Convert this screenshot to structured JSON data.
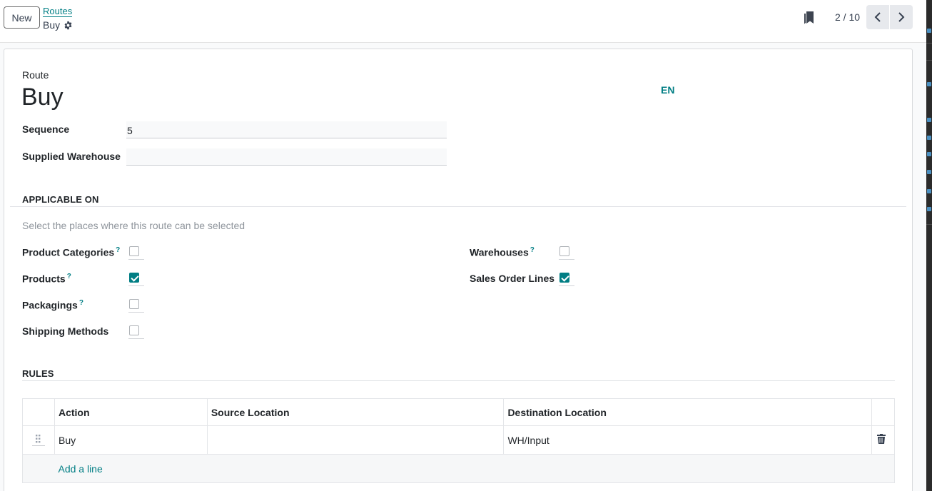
{
  "control_panel": {
    "new_button": "New",
    "breadcrumb_parent": "Routes",
    "breadcrumb_current": "Buy",
    "pager": "2 / 10"
  },
  "form": {
    "route_label": "Route",
    "route_name": "Buy",
    "language": "EN",
    "sequence_label": "Sequence",
    "sequence_value": "5",
    "supplied_warehouse_label": "Supplied Warehouse",
    "supplied_warehouse_value": ""
  },
  "applicable_on": {
    "title": "APPLICABLE ON",
    "hint": "Select the places where this route can be selected",
    "help_marker": "?",
    "left": [
      {
        "label": "Product Categories",
        "help": true,
        "checked": false
      },
      {
        "label": "Products",
        "help": true,
        "checked": true
      },
      {
        "label": "Packagings",
        "help": true,
        "checked": false
      },
      {
        "label": "Shipping Methods",
        "help": false,
        "checked": false
      }
    ],
    "right": [
      {
        "label": "Warehouses",
        "help": true,
        "checked": false
      },
      {
        "label": "Sales Order Lines",
        "help": false,
        "checked": true
      }
    ]
  },
  "rules": {
    "title": "RULES",
    "columns": [
      "Action",
      "Source Location",
      "Destination Location"
    ],
    "rows": [
      {
        "action": "Buy",
        "source": "",
        "destination": "WH/Input"
      }
    ],
    "add_line": "Add a line"
  },
  "colors": {
    "accent": "#017e84",
    "pager_bg": "#e7e9ed"
  },
  "icons": [
    "gear-icon",
    "bookmark-icon",
    "chevron-left-icon",
    "chevron-right-icon",
    "drag-handle-icon",
    "trash-icon"
  ]
}
